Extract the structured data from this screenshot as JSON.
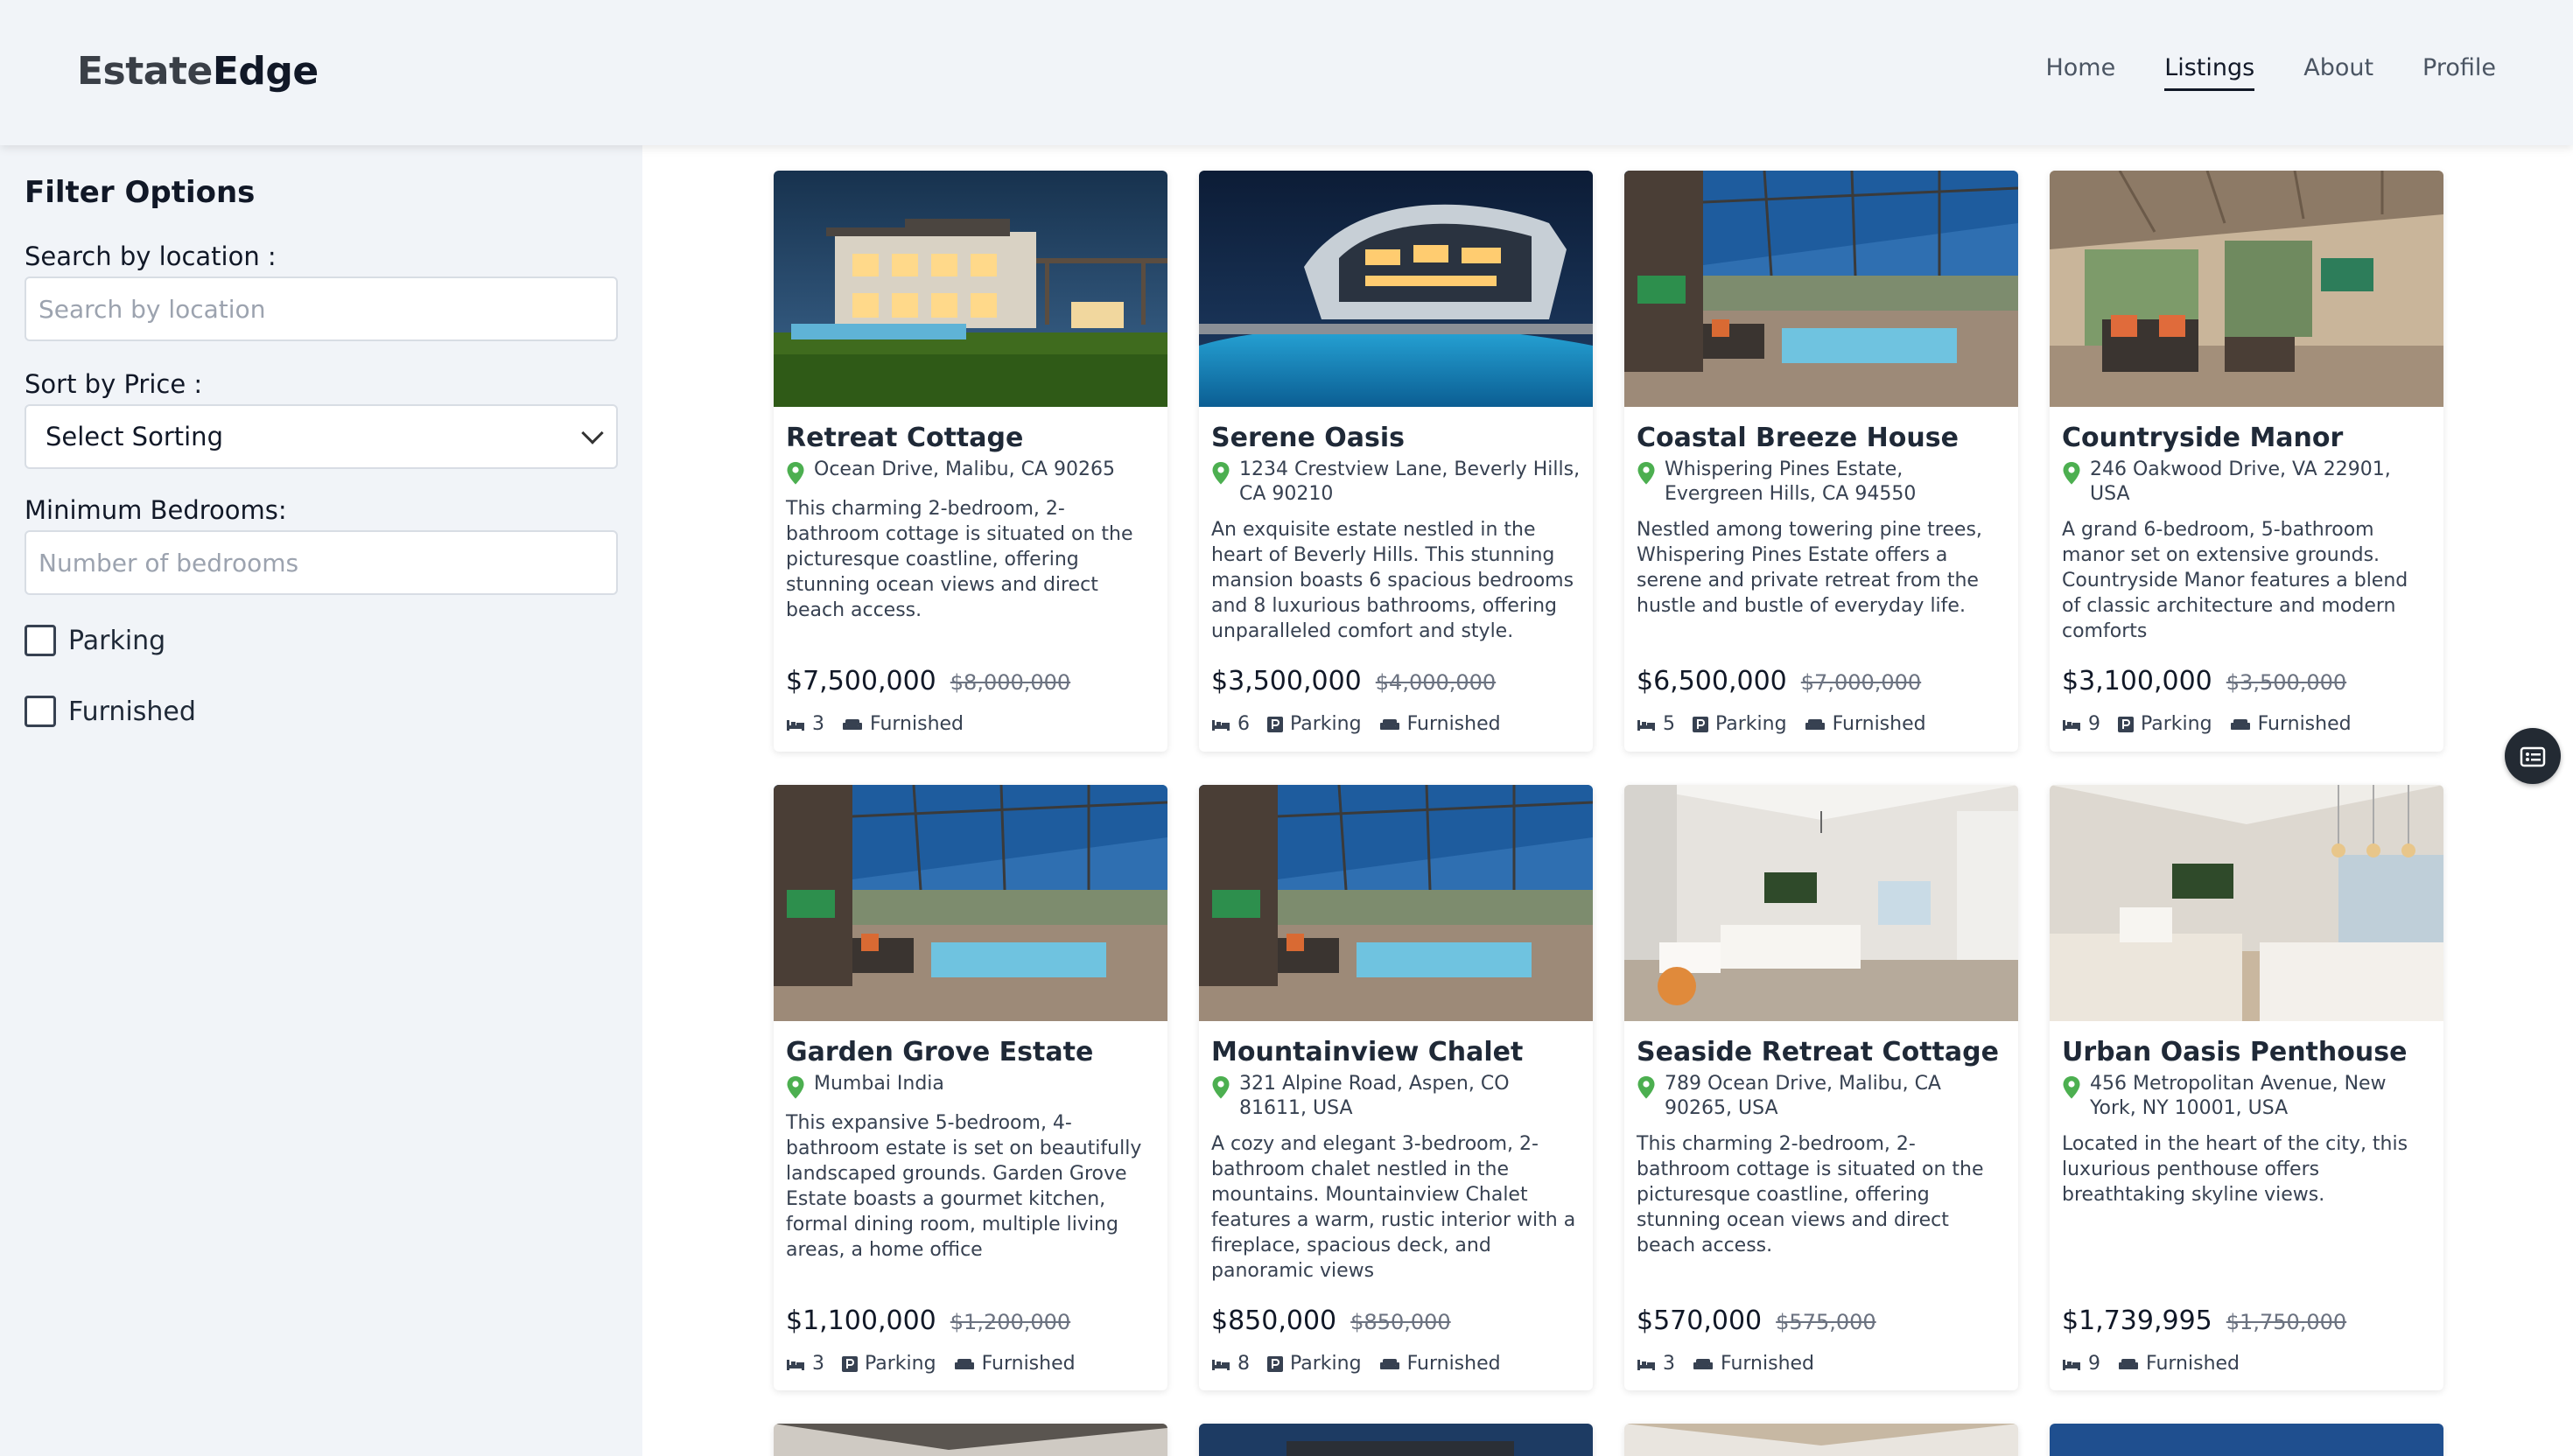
{
  "brand": {
    "part1": "Estate",
    "part2": "Edge"
  },
  "nav": {
    "home": "Home",
    "listings": "Listings",
    "about": "About",
    "profile": "Profile"
  },
  "filters": {
    "title": "Filter Options",
    "location_label": "Search by location :",
    "location_placeholder": "Search by location",
    "sort_label": "Sort by Price :",
    "sort_value": "Select Sorting",
    "bedrooms_label": "Minimum Bedrooms:",
    "bedrooms_placeholder": "Number of bedrooms",
    "parking_label": "Parking",
    "furnished_label": "Furnished"
  },
  "amenity_labels": {
    "parking": "Parking",
    "furnished": "Furnished"
  },
  "listings": [
    {
      "title": "Retreat Cottage",
      "address": "Ocean Drive, Malibu, CA 90265",
      "description": "This charming 2-bedroom, 2-bathroom cottage is situated on the picturesque coastline, offering stunning ocean views and direct beach access.",
      "price": "$7,500,000",
      "old_price": "$8,000,000",
      "bedrooms": "3"
    },
    {
      "title": "Serene Oasis",
      "address": "1234 Crestview Lane, Beverly Hills, CA 90210",
      "description": "An exquisite estate nestled in the heart of Beverly Hills. This stunning mansion boasts 6 spacious bedrooms and 8 luxurious bathrooms, offering unparalleled comfort and style.",
      "price": "$3,500,000",
      "old_price": "$4,000,000",
      "bedrooms": "6"
    },
    {
      "title": "Coastal Breeze House",
      "address": "Whispering Pines Estate, Evergreen Hills, CA 94550",
      "description": "Nestled among towering pine trees, Whispering Pines Estate offers a serene and private retreat from the hustle and bustle of everyday life.",
      "price": "$6,500,000",
      "old_price": "$7,000,000",
      "bedrooms": "5"
    },
    {
      "title": "Countryside Manor",
      "address": "246 Oakwood Drive, VA 22901, USA",
      "description": "A grand 6-bedroom, 5-bathroom manor set on extensive grounds. Countryside Manor features a blend of classic architecture and modern comforts",
      "price": "$3,100,000",
      "old_price": "$3,500,000",
      "bedrooms": "9"
    },
    {
      "title": "Garden Grove Estate",
      "address": "Mumbai India",
      "description": "This expansive 5-bedroom, 4-bathroom estate is set on beautifully landscaped grounds. Garden Grove Estate boasts a gourmet kitchen, formal dining room, multiple living areas, a home office",
      "price": "$1,100,000",
      "old_price": "$1,200,000",
      "bedrooms": "3"
    },
    {
      "title": "Mountainview Chalet",
      "address": "321 Alpine Road, Aspen, CO 81611, USA",
      "description": "A cozy and elegant 3-bedroom, 2-bathroom chalet nestled in the mountains. Mountainview Chalet features a warm, rustic interior with a fireplace, spacious deck, and panoramic views",
      "price": "$850,000",
      "old_price": "$850,000",
      "bedrooms": "8"
    },
    {
      "title": "Seaside Retreat Cottage",
      "address": "789 Ocean Drive, Malibu, CA 90265, USA",
      "description": "This charming 2-bedroom, 2-bathroom cottage is situated on the picturesque coastline, offering stunning ocean views and direct beach access.",
      "price": "$570,000",
      "old_price": "$575,000",
      "bedrooms": "3"
    },
    {
      "title": "Urban Oasis Penthouse",
      "address": "456 Metropolitan Avenue, New York, NY 10001, USA",
      "description": "Located in the heart of the city, this luxurious penthouse offers breathtaking skyline views.",
      "price": "$1,739,995",
      "old_price": "$1,750,000",
      "bedrooms": "9"
    }
  ],
  "colors": {
    "pin": "#4caf50",
    "header_bg": "#f1f4f8",
    "fab_bg": "#232a33"
  },
  "icons": {
    "pin": "map-pin-icon",
    "bed": "bed-icon",
    "parking": "parking-icon",
    "sofa": "sofa-icon",
    "fab": "filter-list-icon"
  }
}
